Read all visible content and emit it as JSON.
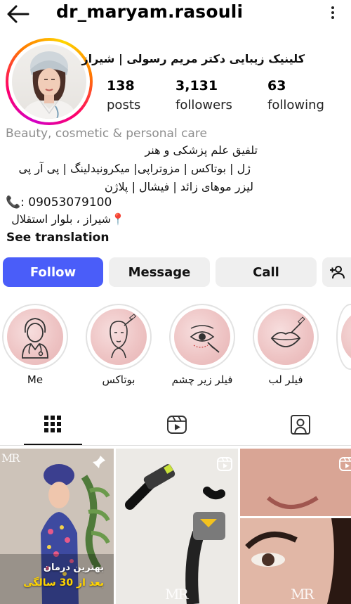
{
  "header": {
    "username": "dr_maryam.rasouli"
  },
  "profile": {
    "bio_name": "کلینیک زیبایی دکتر مریم رسولی | شیراز",
    "stats": [
      {
        "value": "138",
        "label": "posts"
      },
      {
        "value": "3,131",
        "label": "followers"
      },
      {
        "value": "63",
        "label": "following"
      }
    ],
    "category": "Beauty, cosmetic & personal care",
    "bio_lines": [
      "تلفیق علم پزشکی و هنر",
      "ژل | بوتاکس | مزوتراپی| میکرونیدلینگ | پی آر پی",
      "لیزر موهای زائد | فیشال | پلاژن"
    ],
    "phone": "📞: 09053079100",
    "address": "📍شیراز ، بلوار استقلال",
    "see_translation": "See translation"
  },
  "actions": {
    "follow": "Follow",
    "message": "Message",
    "call": "Call"
  },
  "highlights": [
    {
      "label": "Me",
      "icon": "doctor-icon"
    },
    {
      "label": "بوتاکس",
      "icon": "botox-face-icon"
    },
    {
      "label": "فیلر زیر چشم",
      "icon": "under-eye-filler-icon"
    },
    {
      "label": "فیلر لب",
      "icon": "lip-filler-icon"
    }
  ],
  "tabs": [
    {
      "name": "grid-icon",
      "active": true
    },
    {
      "name": "reels-icon",
      "active": false
    },
    {
      "name": "tagged-icon",
      "active": false
    }
  ],
  "posts": [
    {
      "caption_line1": "بهترین درمان",
      "caption_line2": "بعد از 30 سالگی",
      "badge": "pin-icon",
      "logo": "MR"
    },
    {
      "badge": "reel-icon",
      "logo": "MR"
    },
    {
      "badge": "reel-icon",
      "logo": "MR"
    }
  ],
  "colors": {
    "follow_button": "#4a5df9",
    "button_gray": "#efefef",
    "category_gray": "#8e8e8e"
  }
}
